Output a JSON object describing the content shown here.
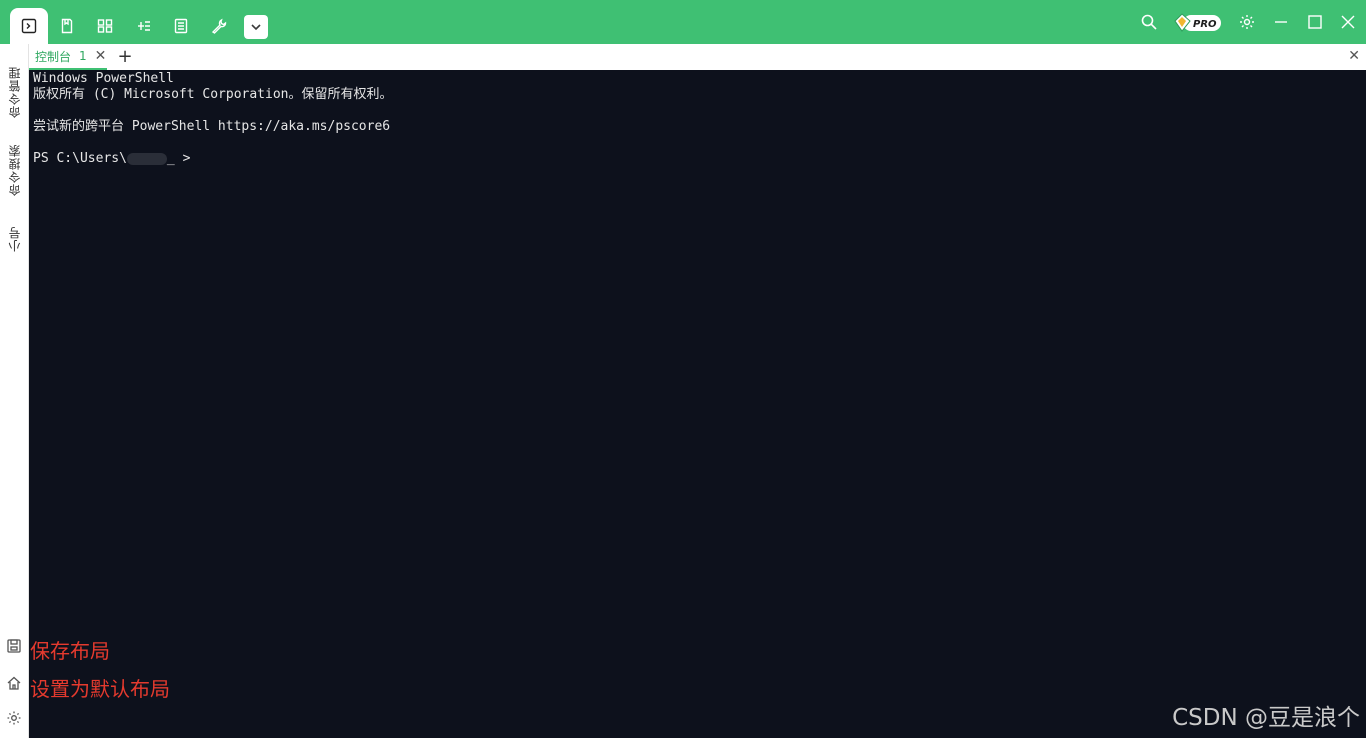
{
  "toolbar": {
    "icons": [
      "terminal-icon",
      "bookmark-icon",
      "layout-icon",
      "tree-icon",
      "document-icon",
      "wrench-icon",
      "chevron-down-icon"
    ],
    "accent": "#3fc073",
    "pro_badge": "PRO"
  },
  "sidebar": {
    "items": [
      {
        "label": "命令管理"
      },
      {
        "label": "命令搜索"
      },
      {
        "label": "小号"
      }
    ]
  },
  "tabs": [
    {
      "label": "控制台",
      "count": "1"
    }
  ],
  "terminal": {
    "lines": [
      "Windows PowerShell",
      "版权所有 (C) Microsoft Corporation。保留所有权利。",
      "",
      "尝试新的跨平台 PowerShell https://aka.ms/pscore6",
      "",
      "PS C:\\Users\\"
    ],
    "prompt_end": "_ >"
  },
  "annotations": {
    "save_layout": "保存布局",
    "set_default_layout": "设置为默认布局"
  },
  "watermark": "CSDN @豆是浪个"
}
